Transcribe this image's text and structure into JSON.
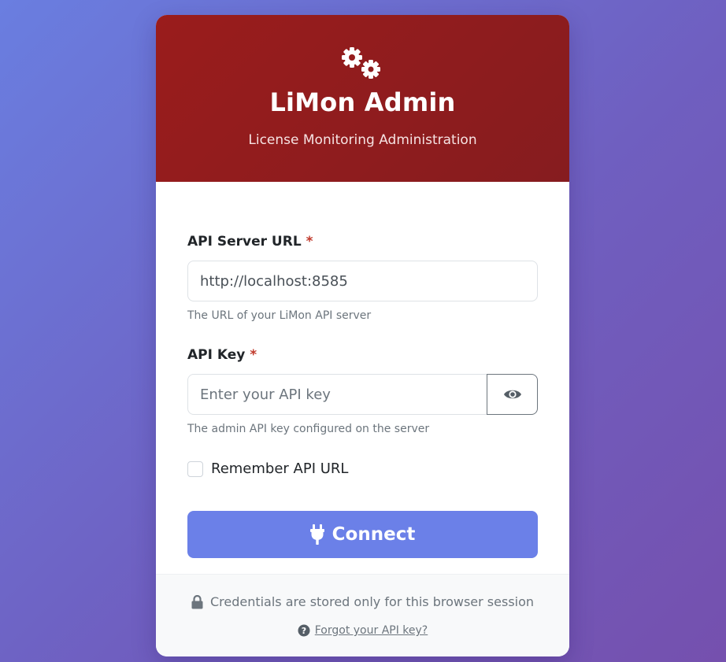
{
  "header": {
    "icon": "gears-icon",
    "title": "LiMon Admin",
    "subtitle": "License Monitoring Administration"
  },
  "form": {
    "api_url": {
      "label": "API Server URL",
      "required_mark": "*",
      "value": "http://localhost:8585",
      "placeholder": "",
      "help": "The URL of your LiMon API server"
    },
    "api_key": {
      "label": "API Key",
      "required_mark": "*",
      "value": "",
      "placeholder": "Enter your API key",
      "help": "The admin API key configured on the server",
      "toggle_icon": "eye-icon"
    },
    "remember": {
      "label": "Remember API URL",
      "checked": false
    },
    "connect": {
      "icon": "plug-icon",
      "label": "Connect"
    }
  },
  "footer": {
    "note_icon": "lock-icon",
    "note": "Credentials are stored only for this browser session",
    "help_icon": "question-circle-icon",
    "forgot_link": "Forgot your API key?"
  },
  "colors": {
    "header": "#9a1c1c",
    "primary_button": "#6b80e8",
    "background_start": "#6a7ee0",
    "background_end": "#7550ae"
  }
}
